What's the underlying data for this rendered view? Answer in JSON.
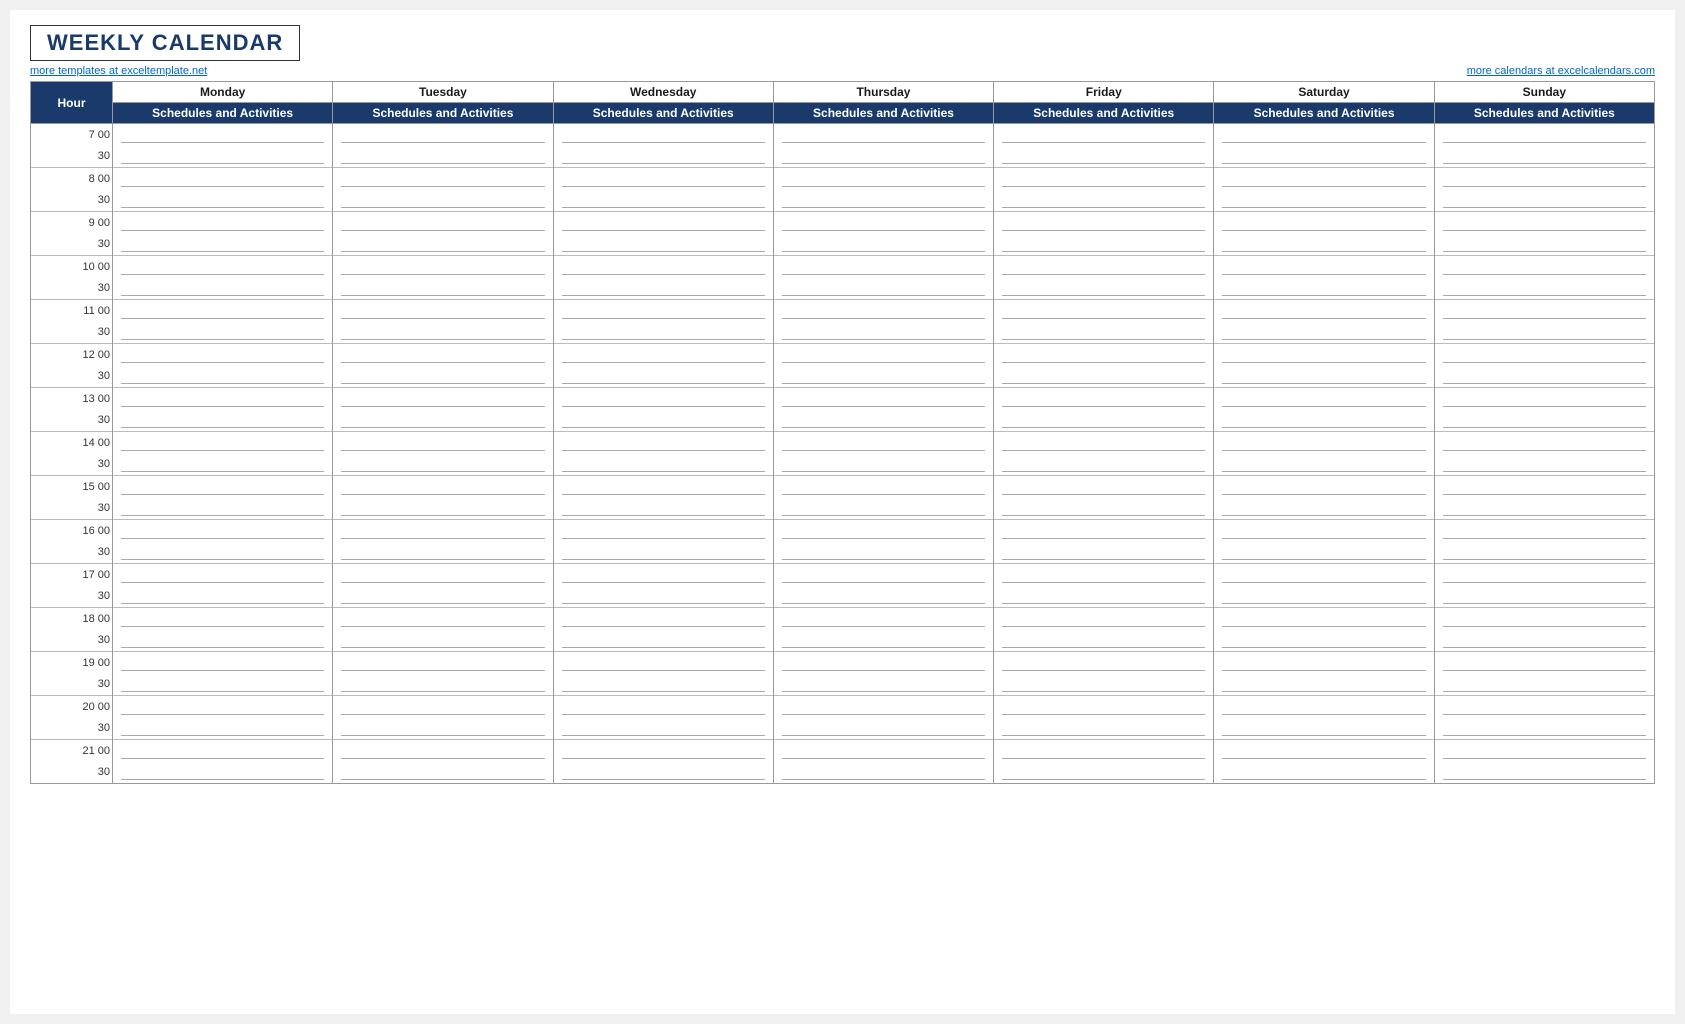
{
  "title": "WEEKLY CALENDAR",
  "link_left": "more templates at exceltemplate.net",
  "link_right": "more calendars at excelcalendars.com",
  "hour_col": "Hour",
  "days": [
    "Monday",
    "Tuesday",
    "Wednesday",
    "Thursday",
    "Friday",
    "Saturday",
    "Sunday"
  ],
  "sub_header": "Schedules and Activities",
  "hours": [
    {
      "label": "7  00",
      "half": "30"
    },
    {
      "label": "8  00",
      "half": "30"
    },
    {
      "label": "9  00",
      "half": "30"
    },
    {
      "label": "10  00",
      "half": "30"
    },
    {
      "label": "11  00",
      "half": "30"
    },
    {
      "label": "12  00",
      "half": "30"
    },
    {
      "label": "13  00",
      "half": "30"
    },
    {
      "label": "14  00",
      "half": "30"
    },
    {
      "label": "15  00",
      "half": "30"
    },
    {
      "label": "16  00",
      "half": "30"
    },
    {
      "label": "17  00",
      "half": "30"
    },
    {
      "label": "18  00",
      "half": "30"
    },
    {
      "label": "19  00",
      "half": "30"
    },
    {
      "label": "20  00",
      "half": "30"
    },
    {
      "label": "21  00",
      "half": "30"
    }
  ]
}
